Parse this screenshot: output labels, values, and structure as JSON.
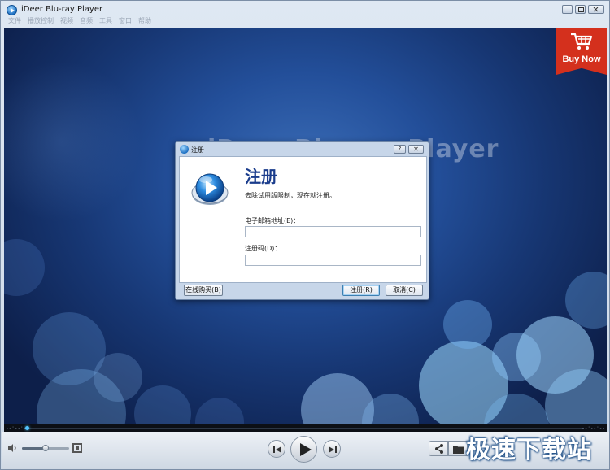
{
  "window": {
    "title": "iDeer Blu-ray Player"
  },
  "menu": [
    "文件",
    "播放控制",
    "视频",
    "音频",
    "工具",
    "窗口",
    "帮助"
  ],
  "video": {
    "splash_title": "iDeer Blu-ray Player",
    "buy_now_label": "Buy Now"
  },
  "dialog": {
    "title": "注册",
    "help_label": "?",
    "close_label": "✕",
    "heading": "注册",
    "subtitle": "去除试用版限制，现在就注册。",
    "email_label": "电子邮箱地址(E)：",
    "email_value": "",
    "code_label": "注册码(D)：",
    "code_value": "",
    "buy_online_button": "在线购买(B)",
    "register_button": "注册(R)",
    "cancel_button": "取消(C)"
  },
  "seek": {
    "elapsed": "--:--:--",
    "total": "--:--:--",
    "progress": 0.0
  },
  "volume": {
    "level": 0.5
  },
  "icons": [
    "app-logo-icon",
    "cart-icon",
    "volume-icon",
    "fullscreen-icon",
    "previous-icon",
    "play-icon",
    "next-icon",
    "share-icon",
    "folder-icon"
  ],
  "watermark": "极速下载站",
  "colors": {
    "buy_now": "#d4301d",
    "dialog_heading": "#1a3c8c",
    "seek_knob": "#52c5ff"
  }
}
